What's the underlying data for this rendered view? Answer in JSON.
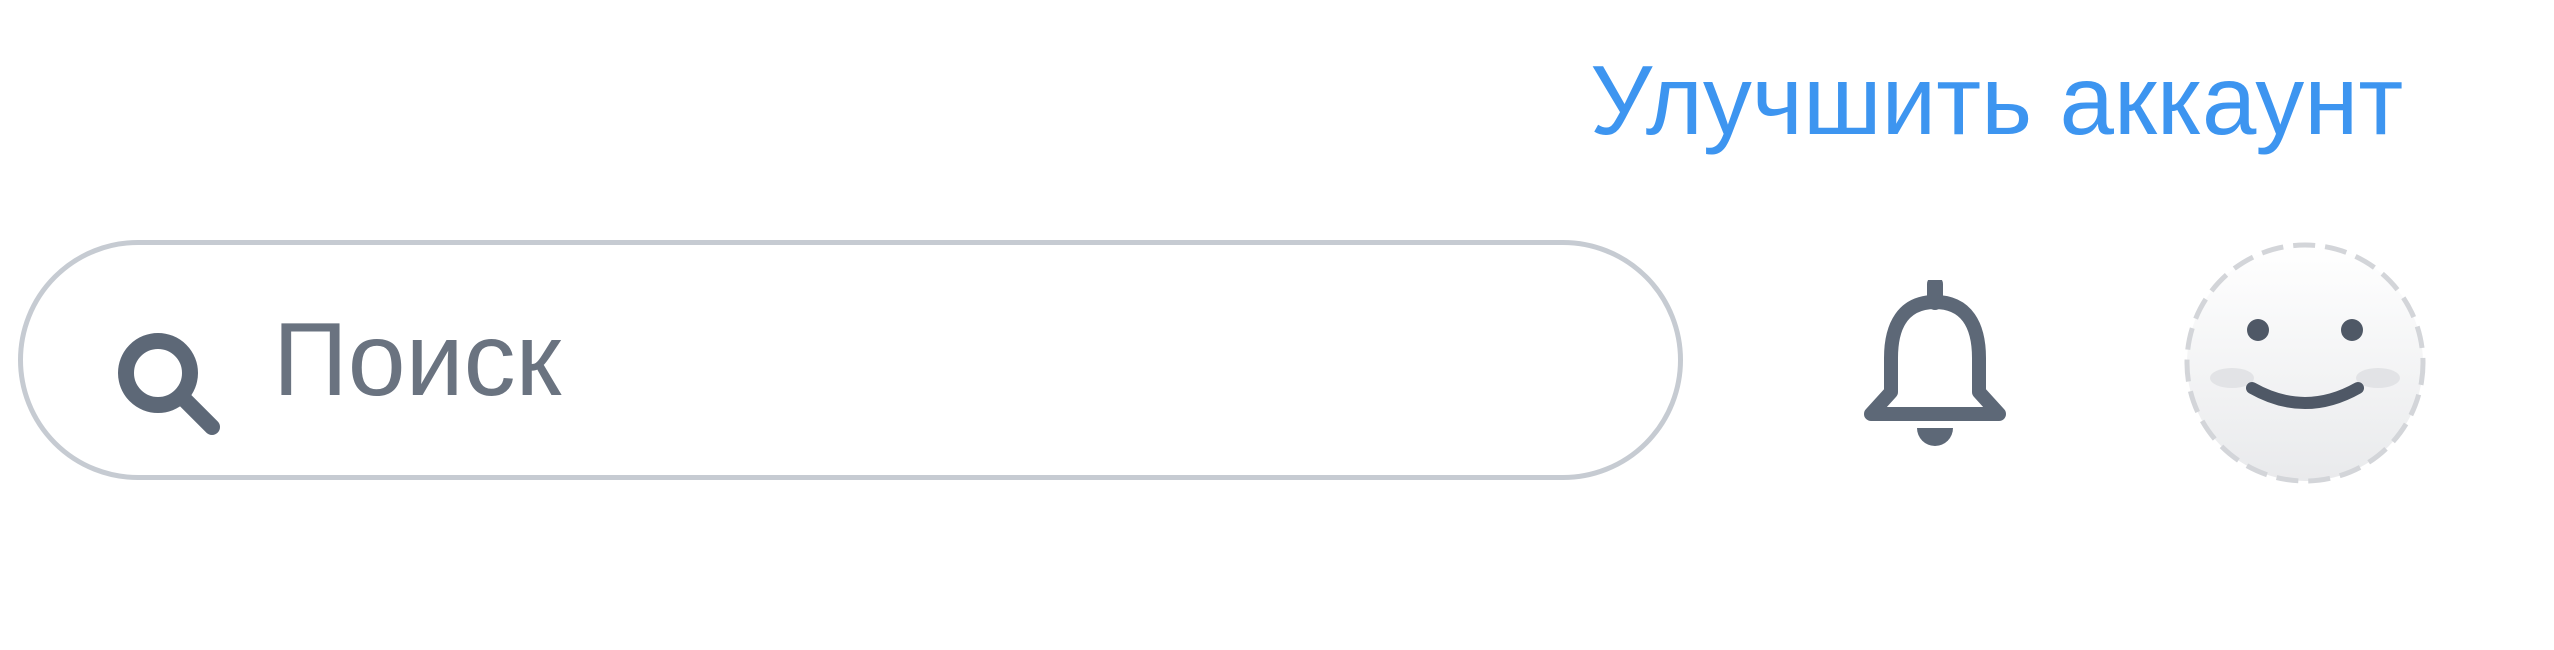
{
  "header": {
    "upgrade_link": "Улучшить аккаунт"
  },
  "search": {
    "placeholder": "Поиск",
    "value": ""
  },
  "icons": {
    "search": "search-icon",
    "notifications": "bell-icon",
    "avatar": "smiley-avatar"
  },
  "colors": {
    "link": "#3d95f0",
    "icon": "#5d6877",
    "border": "#c6cbd2"
  }
}
